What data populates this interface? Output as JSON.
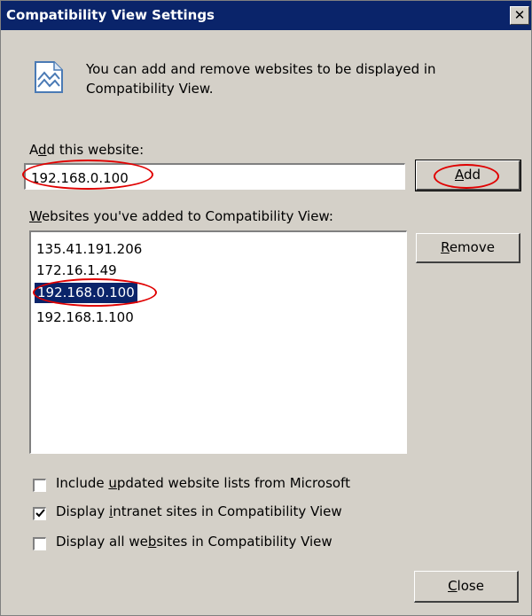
{
  "window": {
    "title": "Compatibility View Settings",
    "close_glyph": "✕"
  },
  "info": {
    "icon": "compatibility-view-icon",
    "text": "You can add and remove websites to be displayed in Compatibility View."
  },
  "add_section": {
    "label_before": "A",
    "label_mnemonic": "d",
    "label_after": "d this website:",
    "input_value": "192.168.0.100",
    "add_button_mnemonic": "A",
    "add_button_rest": "dd"
  },
  "list_section": {
    "label_before": "",
    "label_mnemonic": "W",
    "label_after": "ebsites you've added to Compatibility View:",
    "items": [
      "135.41.191.206",
      "172.16.1.49",
      "192.168.0.100",
      "192.168.1.100"
    ],
    "selected_index": 2,
    "remove_button_mnemonic": "R",
    "remove_button_rest": "emove"
  },
  "options": [
    {
      "before": "Include ",
      "mnemonic": "u",
      "after": "pdated website lists from Microsoft",
      "checked": false
    },
    {
      "before": "Display ",
      "mnemonic": "i",
      "after": "ntranet sites in Compatibility View",
      "checked": true
    },
    {
      "before": "Display all we",
      "mnemonic": "b",
      "after": "sites in Compatibility View",
      "checked": false
    }
  ],
  "footer": {
    "close_button_mnemonic": "C",
    "close_button_rest": "lose"
  },
  "colors": {
    "titlebar": "#0a246a",
    "dialog_bg": "#d4d0c8",
    "annotation": "#e00000",
    "selection": "#0a246a"
  }
}
